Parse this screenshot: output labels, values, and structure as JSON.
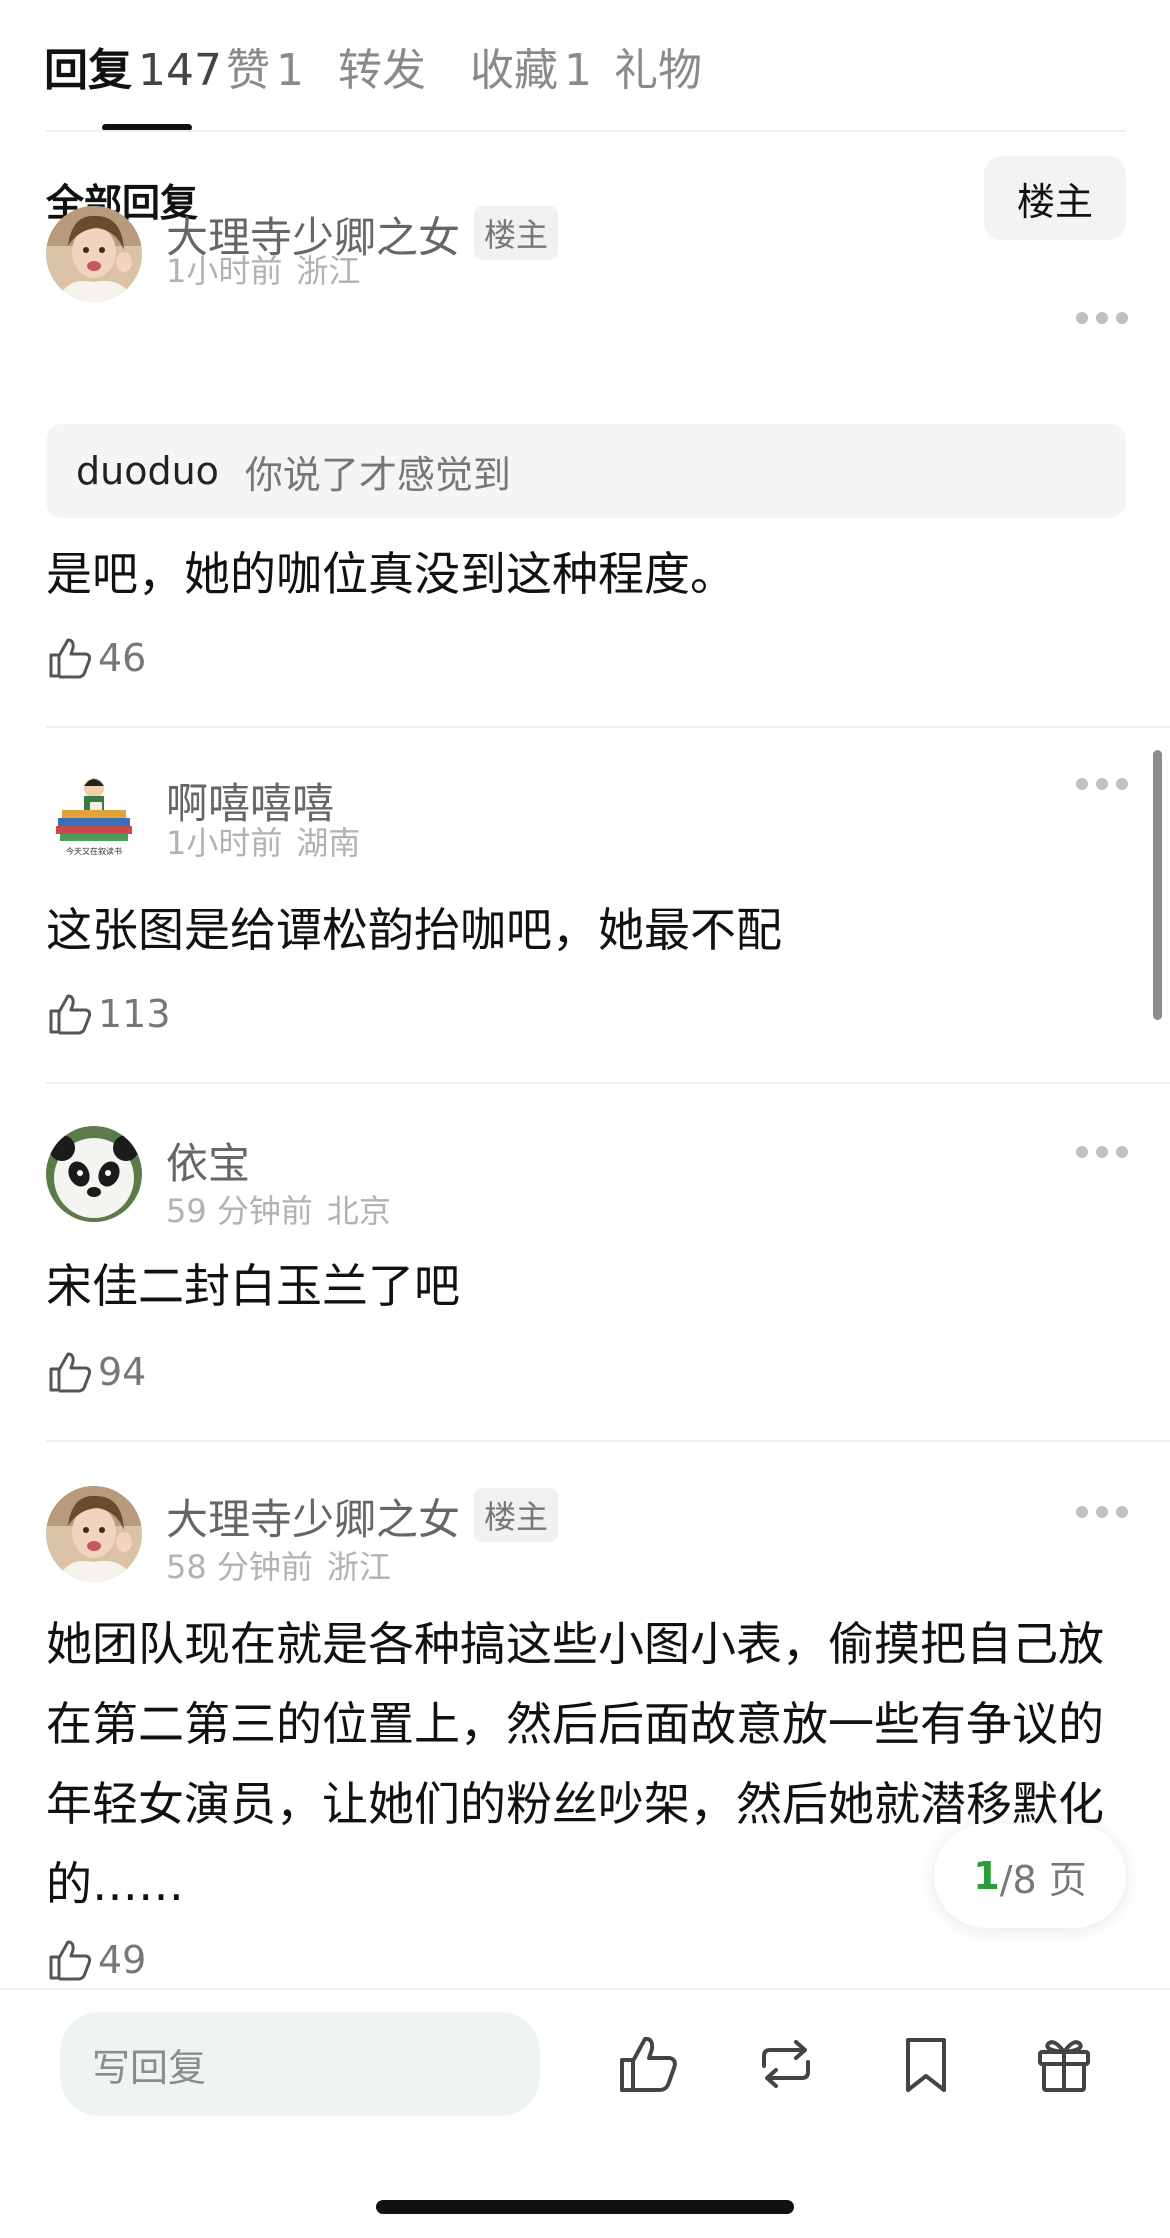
{
  "tabs": [
    {
      "label": "回复",
      "count": "147"
    },
    {
      "label": "赞",
      "count": "1"
    },
    {
      "label": "转发",
      "count": ""
    },
    {
      "label": "收藏",
      "count": "1"
    },
    {
      "label": "礼物",
      "count": ""
    }
  ],
  "filter": {
    "title": "全部回复",
    "op_only_label": "楼主"
  },
  "comments": [
    {
      "username": "大理寺少卿之女",
      "badge": "楼主",
      "time": "1小时前",
      "location": "浙江",
      "quote": {
        "user": "duoduo",
        "text": "你说了才感觉到"
      },
      "text": "是吧，她的咖位真没到这种程度。",
      "likes": "46",
      "avatar": "woman-photo-avatar"
    },
    {
      "username": "啊嘻嘻嘻",
      "time": "1小时前",
      "location": "湖南",
      "text": "这张图是给谭松韵抬咖吧，她最不配",
      "likes": "113",
      "avatar": "books-cartoon-avatar",
      "avatar_caption": "今天又在叙读书"
    },
    {
      "username": "依宝",
      "time": "59 分钟前",
      "location": "北京",
      "text": "宋佳二封白玉兰了吧",
      "likes": "94",
      "avatar": "panda-avatar"
    },
    {
      "username": "大理寺少卿之女",
      "badge": "楼主",
      "time": "58 分钟前",
      "location": "浙江",
      "text": "她团队现在就是各种搞这些小图小表，偷摸把自己放在第二第三的位置上，然后后面故意放一些有争议的年轻女演员，让她们的粉丝吵架，然后她就潜移默化的……",
      "likes": "49",
      "avatar": "woman-photo-avatar"
    }
  ],
  "pagination": {
    "current": "1",
    "total_text": "/8 页"
  },
  "bottom_bar": {
    "reply_placeholder": "写回复"
  },
  "colors": {
    "accent_green": "#2a9d3a",
    "text_primary": "#111111",
    "text_secondary": "#8a8a8a"
  }
}
